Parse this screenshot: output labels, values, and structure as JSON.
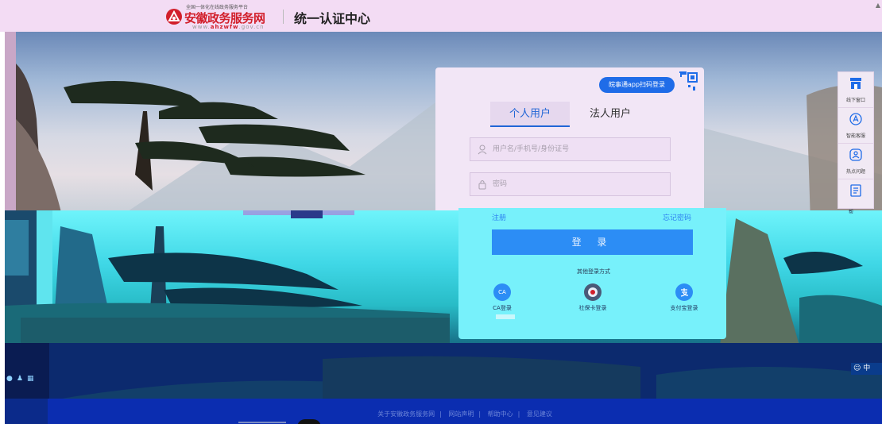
{
  "header": {
    "logo_small": "全国一体化在线政务服务平台",
    "logo_name": "安徽政务服务网",
    "logo_url_prefix": "www.",
    "logo_url_brand": "ahzwfw",
    "logo_url_suffix": ".gov.cn",
    "title": "统一认证中心"
  },
  "login": {
    "qr_login_label": "皖事通app扫码登录",
    "tabs": [
      "个人用户",
      "法人用户"
    ],
    "username_placeholder": "用户名/手机号/身份证号",
    "password_placeholder": "密码",
    "register_label": "注册",
    "forgot_label": "忘记密码",
    "login_button": "登 录",
    "other_methods_title": "其他登录方式",
    "alt_methods": [
      {
        "label": "CA登录",
        "icon": "CA"
      },
      {
        "label": "社保卡登录",
        "icon": "social-security-card-icon"
      },
      {
        "label": "支付宝登录",
        "icon": "alipay-icon"
      }
    ]
  },
  "side_tools": {
    "items": [
      {
        "label": "线下窗口",
        "icon": "store-icon"
      },
      {
        "label": "智能客服",
        "icon": "robot-icon"
      },
      {
        "label": "热点问题",
        "icon": "question-icon"
      },
      {
        "label": "",
        "icon": "survey-icon"
      }
    ],
    "lower_fragment": "帮"
  },
  "lang_switch": "中",
  "footer": {
    "links": [
      "关于安徽政务服务网",
      "网站声明",
      "帮助中心",
      "意见建议"
    ]
  },
  "colors": {
    "brand_red": "#d21f2b",
    "primary_blue": "#2c8df5",
    "header_bg": "#f3dcf4"
  }
}
